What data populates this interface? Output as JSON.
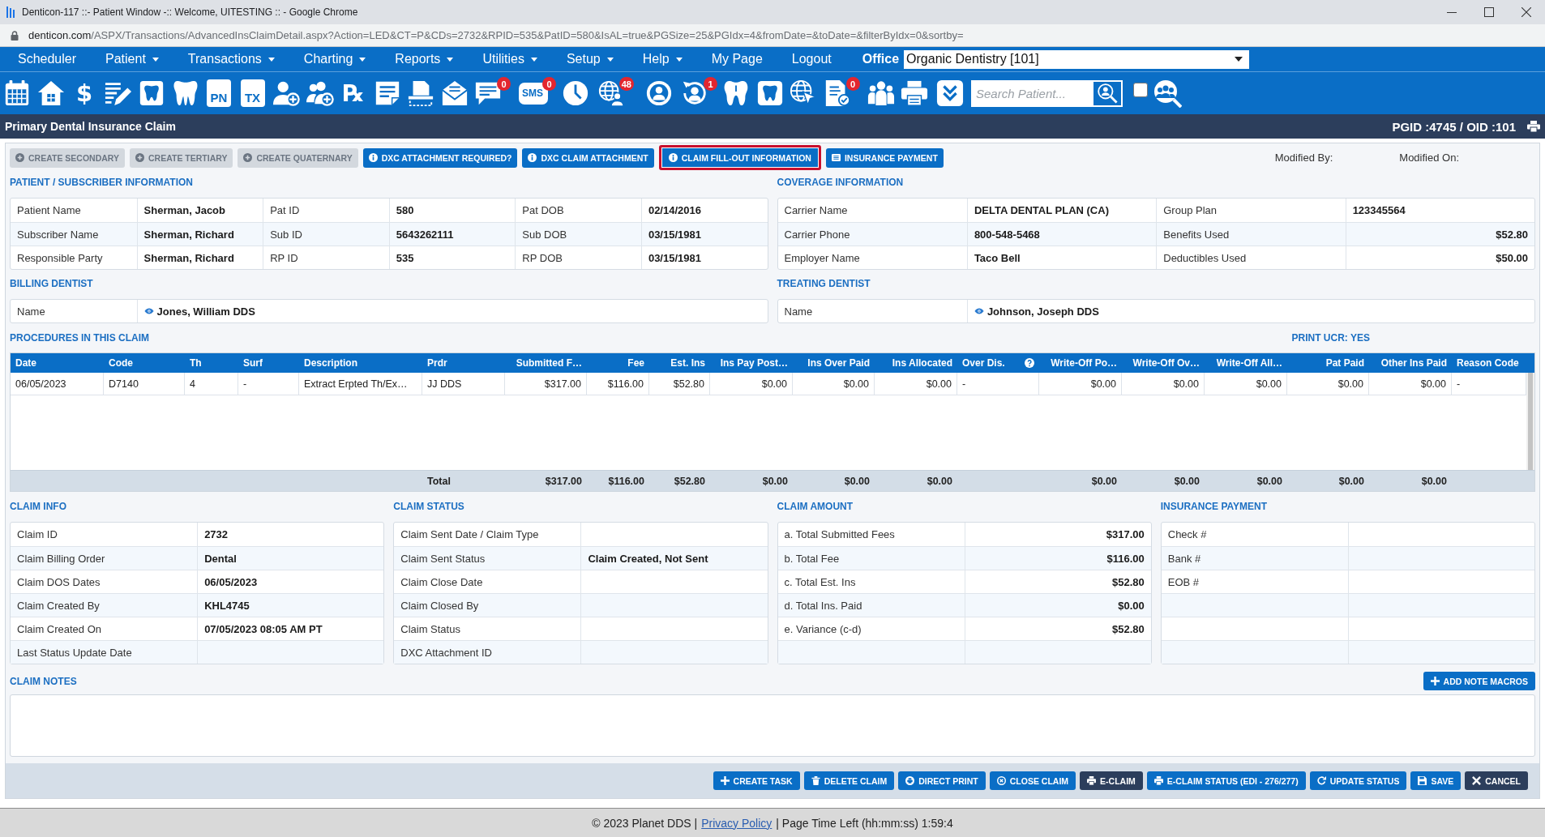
{
  "window": {
    "title": "Denticon-117 ::- Patient Window -:: Welcome, UITESTING :: - Google Chrome"
  },
  "address_bar": {
    "host": "denticon.com",
    "path": "/ASPX/Transactions/AdvancedInsClaimDetail.aspx?Action=LED&CT=P&CDs=2732&RPID=535&PatID=580&IsAL=true&PGSize=25&PGIdx=4&fromDate=&toDate=&filterByIdx=0&sortby="
  },
  "menu": {
    "items": [
      {
        "label": "Scheduler",
        "dropdown": false
      },
      {
        "label": "Patient",
        "dropdown": true
      },
      {
        "label": "Transactions",
        "dropdown": true
      },
      {
        "label": "Charting",
        "dropdown": true
      },
      {
        "label": "Reports",
        "dropdown": true
      },
      {
        "label": "Utilities",
        "dropdown": true
      },
      {
        "label": "Setup",
        "dropdown": true
      },
      {
        "label": "Help",
        "dropdown": true
      },
      {
        "label": "My Page",
        "dropdown": false
      },
      {
        "label": "Logout",
        "dropdown": false
      }
    ],
    "office": {
      "label": "Office",
      "value": "Organic Dentistry [101]"
    }
  },
  "toolbar": {
    "icon_labels": [
      "$",
      "PN",
      "TX",
      "℞",
      "SMS"
    ],
    "badges": [
      "0",
      "0",
      "48",
      "1",
      "0"
    ],
    "search": {
      "placeholder": "Search Patient..."
    },
    "checkbox": {
      "checked": false
    }
  },
  "header": {
    "title": "Primary Dental Insurance Claim",
    "ids": "PGID :4745 / OID :101"
  },
  "actions": [
    {
      "label": "CREATE SECONDARY",
      "kind": "create",
      "disabled": true,
      "highlighted": false
    },
    {
      "label": "CREATE TERTIARY",
      "kind": "create",
      "disabled": true,
      "highlighted": false
    },
    {
      "label": "CREATE QUATERNARY",
      "kind": "create",
      "disabled": true,
      "highlighted": false
    },
    {
      "label": "DXC ATTACHMENT REQUIRED?",
      "kind": "info",
      "disabled": false,
      "highlighted": false
    },
    {
      "label": "DXC CLAIM ATTACHMENT",
      "kind": "info",
      "disabled": false,
      "highlighted": false
    },
    {
      "label": "CLAIM FILL-OUT INFORMATION",
      "kind": "info",
      "disabled": false,
      "highlighted": true
    },
    {
      "label": "INSURANCE PAYMENT",
      "kind": "payment",
      "disabled": false,
      "highlighted": false
    }
  ],
  "modified": {
    "by": "Modified By:",
    "on": "Modified On:"
  },
  "patient_subscriber": {
    "title": "PATIENT / SUBSCRIBER INFORMATION",
    "rows": [
      [
        {
          "label": "Patient Name",
          "value": "Sherman, Jacob",
          "kind": "text"
        },
        {
          "label": "Pat ID",
          "value": "580",
          "kind": "text"
        },
        {
          "label": "Pat DOB",
          "value": "02/14/2016",
          "kind": "text"
        }
      ],
      [
        {
          "label": "Subscriber Name",
          "value": "Sherman, Richard",
          "kind": "text"
        },
        {
          "label": "Sub ID",
          "value": "5643262111",
          "kind": "text"
        },
        {
          "label": "Sub DOB",
          "value": "03/15/1981",
          "kind": "text"
        }
      ],
      [
        {
          "label": "Responsible Party",
          "value": "Sherman, Richard",
          "kind": "text"
        },
        {
          "label": "RP ID",
          "value": "535",
          "kind": "text"
        },
        {
          "label": "RP DOB",
          "value": "03/15/1981",
          "kind": "text"
        }
      ]
    ]
  },
  "coverage": {
    "title": "COVERAGE INFORMATION",
    "rows": [
      [
        {
          "label": "Carrier Name",
          "value": "DELTA DENTAL PLAN (CA)",
          "kind": "text"
        },
        {
          "label": "Group Plan",
          "value": "123345564",
          "kind": "text"
        }
      ],
      [
        {
          "label": "Carrier Phone",
          "value": "800-548-5468",
          "kind": "text"
        },
        {
          "label": "Benefits Used",
          "value": "$52.80",
          "kind": "amount"
        }
      ],
      [
        {
          "label": "Employer Name",
          "value": "Taco Bell",
          "kind": "text"
        },
        {
          "label": "Deductibles Used",
          "value": "$50.00",
          "kind": "amount"
        }
      ]
    ]
  },
  "billing_dentist": {
    "title": "BILLING DENTIST",
    "label": "Name",
    "value": "Jones, William DDS"
  },
  "treating_dentist": {
    "title": "TREATING DENTIST",
    "label": "Name",
    "value": "Johnson, Joseph DDS"
  },
  "procedures": {
    "title": "PROCEDURES IN THIS CLAIM",
    "print_ucr": "PRINT UCR: YES",
    "columns": [
      {
        "label": "Date",
        "kind": "text"
      },
      {
        "label": "Code",
        "kind": "text"
      },
      {
        "label": "Th",
        "kind": "text"
      },
      {
        "label": "Surf",
        "kind": "text"
      },
      {
        "label": "Description",
        "kind": "text"
      },
      {
        "label": "Prdr",
        "kind": "text"
      },
      {
        "label": "Submitted F…",
        "kind": "amount"
      },
      {
        "label": "Fee",
        "kind": "amount"
      },
      {
        "label": "Est. Ins",
        "kind": "amount"
      },
      {
        "label": "Ins Pay Post…",
        "kind": "amount"
      },
      {
        "label": "Ins Over Paid",
        "kind": "amount"
      },
      {
        "label": "Ins Allocated",
        "kind": "amount"
      },
      {
        "label": "Over Dis.",
        "kind": "text",
        "help": true
      },
      {
        "label": "Write-Off Po…",
        "kind": "amount"
      },
      {
        "label": "Write-Off Ov…",
        "kind": "amount"
      },
      {
        "label": "Write-Off All…",
        "kind": "amount"
      },
      {
        "label": "Pat Paid",
        "kind": "amount"
      },
      {
        "label": "Other Ins Paid",
        "kind": "amount"
      },
      {
        "label": "Reason Code",
        "kind": "text"
      }
    ],
    "rows": [
      {
        "cells": [
          "06/05/2023",
          "D7140",
          "4",
          "-",
          "Extract Erpted Th/Ex…",
          "JJ DDS",
          "$317.00",
          "$116.00",
          "$52.80",
          "$0.00",
          "$0.00",
          "$0.00",
          "-",
          "$0.00",
          "$0.00",
          "$0.00",
          "$0.00",
          "$0.00",
          "-"
        ]
      }
    ],
    "total": {
      "label": "Total",
      "values": [
        "$317.00",
        "$116.00",
        "$52.80",
        "$0.00",
        "$0.00",
        "$0.00",
        "$0.00",
        "$0.00",
        "$0.00",
        "$0.00",
        "$0.00"
      ]
    }
  },
  "claim_sections": [
    {
      "title": "CLAIM INFO",
      "rows": [
        {
          "label": "Claim ID",
          "value": "2732",
          "kind": "text"
        },
        {
          "label": "Claim Billing Order",
          "value": "Dental",
          "kind": "text"
        },
        {
          "label": "Claim DOS Dates",
          "value": "06/05/2023",
          "kind": "text"
        },
        {
          "label": "Claim Created By",
          "value": "KHL4745",
          "kind": "text"
        },
        {
          "label": "Claim Created On",
          "value": "07/05/2023 08:05 AM PT",
          "kind": "text"
        },
        {
          "label": "Last Status Update Date",
          "kind": "text"
        }
      ]
    },
    {
      "title": "CLAIM STATUS",
      "rows": [
        {
          "label": "Claim Sent Date / Claim Type",
          "kind": "text"
        },
        {
          "label": "Claim Sent Status",
          "value": "Claim Created, Not Sent",
          "kind": "text"
        },
        {
          "label": "Claim Close Date",
          "kind": "text"
        },
        {
          "label": "Claim Closed By",
          "kind": "text"
        },
        {
          "label": "Claim Status",
          "kind": "text"
        },
        {
          "label": "DXC Attachment ID",
          "kind": "text"
        }
      ]
    },
    {
      "title": "CLAIM AMOUNT",
      "rows": [
        {
          "label": "a. Total Submitted Fees",
          "value": "$317.00",
          "kind": "amount"
        },
        {
          "label": "b. Total Fee",
          "value": "$116.00",
          "kind": "amount"
        },
        {
          "label": "c. Total Est. Ins",
          "value": "$52.80",
          "kind": "amount"
        },
        {
          "label": "d. Total Ins. Paid",
          "value": "$0.00",
          "kind": "amount"
        },
        {
          "label": "e. Variance (c-d)",
          "value": "$52.80",
          "kind": "amount"
        }
      ]
    },
    {
      "title": "INSURANCE PAYMENT",
      "rows": [
        {
          "label": "Check #",
          "kind": "text"
        },
        {
          "label": "Bank #",
          "kind": "text"
        },
        {
          "label": "EOB #",
          "kind": "text"
        }
      ]
    }
  ],
  "claim_notes": {
    "title": "CLAIM NOTES",
    "button": "ADD NOTE MACROS"
  },
  "bottom_actions": [
    {
      "label": "CREATE TASK",
      "kind": "add"
    },
    {
      "label": "DELETE CLAIM",
      "kind": "delete"
    },
    {
      "label": "DIRECT PRINT",
      "kind": "print"
    },
    {
      "label": "CLOSE CLAIM",
      "kind": "close"
    },
    {
      "label": "E-CLAIM",
      "kind": "eclaim"
    },
    {
      "label": "E-CLAIM STATUS (EDI - 276/277)",
      "kind": "status"
    },
    {
      "label": "UPDATE STATUS",
      "kind": "refresh"
    },
    {
      "label": "SAVE",
      "kind": "save"
    },
    {
      "label": "CANCEL",
      "kind": "cancel"
    }
  ],
  "footer": {
    "copyright": "© 2023 Planet DDS |",
    "link": "Privacy Policy",
    "time_left": "| Page Time Left (hh:mm:ss) 1:59:4"
  }
}
